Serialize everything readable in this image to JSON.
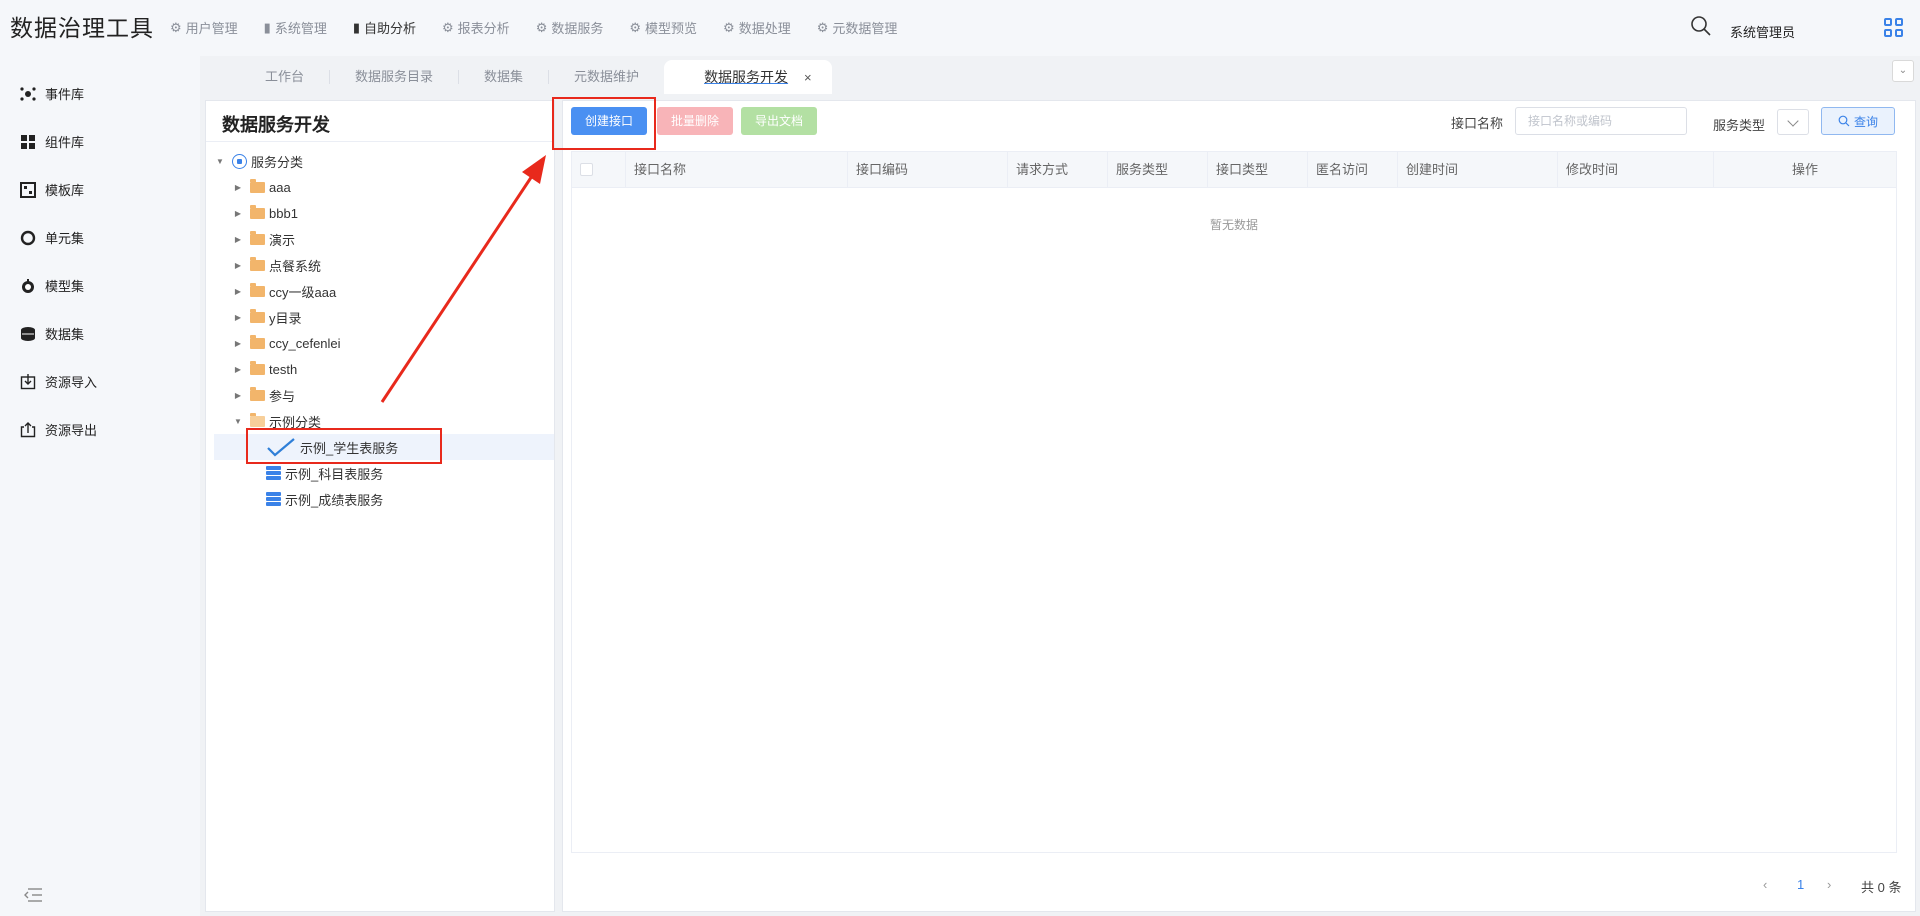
{
  "app": {
    "title": "数据治理工具"
  },
  "topnav": [
    {
      "label": "用户管理",
      "icon": "gear-icon",
      "active": false
    },
    {
      "label": "系统管理",
      "icon": "bar-chart-icon",
      "active": false
    },
    {
      "label": "自助分析",
      "icon": "bar-chart-icon",
      "active": true
    },
    {
      "label": "报表分析",
      "icon": "gear-icon",
      "active": false
    },
    {
      "label": "数据服务",
      "icon": "gear-icon",
      "active": false
    },
    {
      "label": "模型预览",
      "icon": "gear-icon",
      "active": false
    },
    {
      "label": "数据处理",
      "icon": "gear-icon",
      "active": false
    },
    {
      "label": "元数据管理",
      "icon": "gear-icon",
      "active": false
    }
  ],
  "user": {
    "name": "系统管理员"
  },
  "tabs": [
    {
      "label": "工作台",
      "active": false
    },
    {
      "label": "数据服务目录",
      "active": false
    },
    {
      "label": "数据集",
      "active": false
    },
    {
      "label": "元数据维护",
      "active": false
    },
    {
      "label": "数据服务开发",
      "active": true,
      "close": "×"
    }
  ],
  "sidebar": {
    "items": [
      {
        "label": "事件库",
        "icon": "event-icon"
      },
      {
        "label": "组件库",
        "icon": "component-grid-icon"
      },
      {
        "label": "模板库",
        "icon": "template-icon"
      },
      {
        "label": "单元集",
        "icon": "unit-icon"
      },
      {
        "label": "模型集",
        "icon": "model-icon"
      },
      {
        "label": "数据集",
        "icon": "dataset-icon"
      },
      {
        "label": "资源导入",
        "icon": "import-icon"
      },
      {
        "label": "资源导出",
        "icon": "export-icon"
      }
    ]
  },
  "tree": {
    "title": "数据服务开发",
    "root": "服务分类",
    "folders": [
      "aaa",
      "bbb1",
      "演示",
      "点餐系统",
      "ccy一级aaa",
      "y目录",
      "ccy_cefenlei",
      "testh",
      "参与"
    ],
    "open_folder": "示例分类",
    "services": [
      "示例_学生表服务",
      "示例_科目表服务",
      "示例_成绩表服务"
    ],
    "selected": "示例_学生表服务"
  },
  "toolbar": {
    "create": "创建接口",
    "batch_delete": "批量删除",
    "export_doc": "导出文档",
    "name_label": "接口名称",
    "name_placeholder": "接口名称或编码",
    "type_label": "服务类型",
    "query": "查询"
  },
  "table": {
    "columns": [
      "接口名称",
      "接口编码",
      "请求方式",
      "服务类型",
      "接口类型",
      "匿名访问",
      "创建时间",
      "修改时间",
      "操作"
    ],
    "empty": "暂无数据"
  },
  "pagination": {
    "prev": "‹",
    "page": "1",
    "next": "›",
    "total": "共 0 条"
  },
  "colors": {
    "accent": "#3a82e8",
    "annotation": "#e8291c"
  }
}
